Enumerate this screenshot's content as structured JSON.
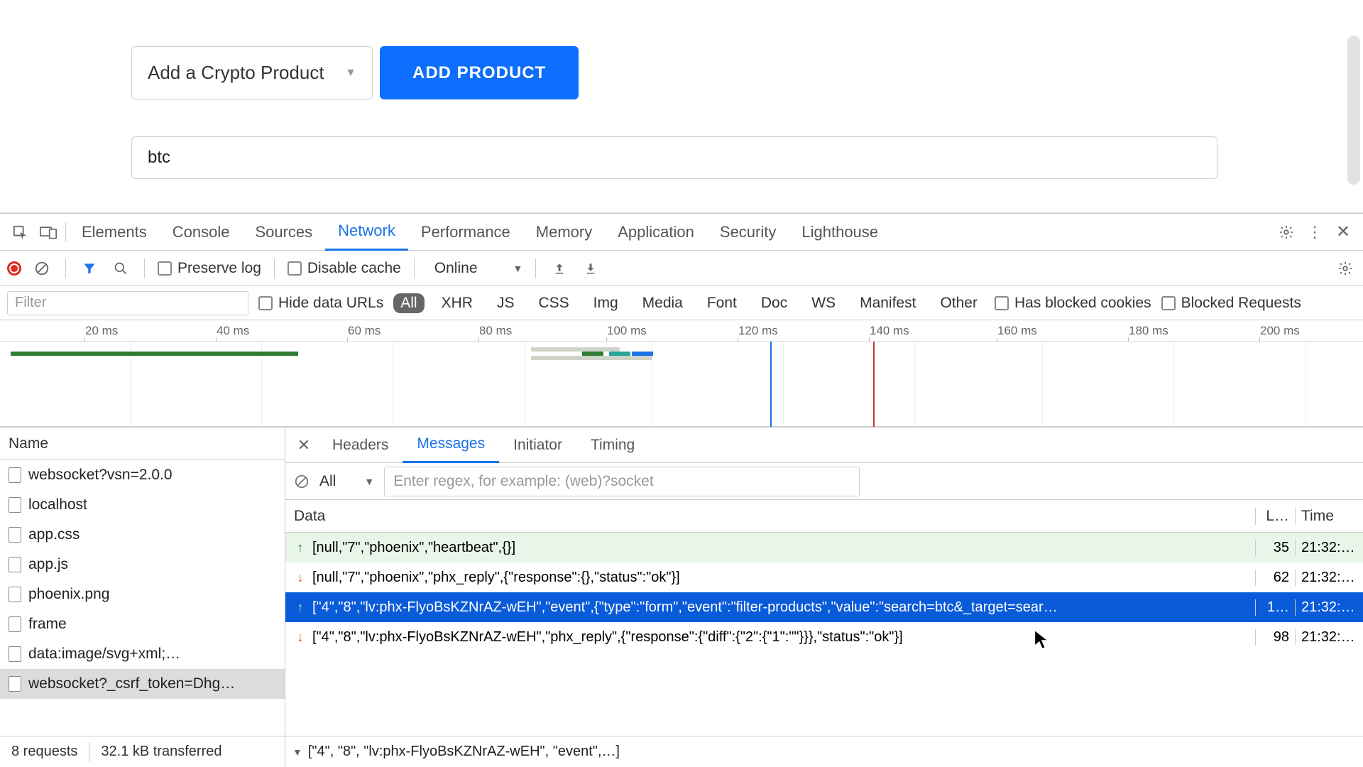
{
  "page": {
    "select_label": "Add a Crypto Product",
    "add_button": "ADD PRODUCT",
    "search_value": "btc"
  },
  "devtools": {
    "tabs": [
      "Elements",
      "Console",
      "Sources",
      "Network",
      "Performance",
      "Memory",
      "Application",
      "Security",
      "Lighthouse"
    ],
    "active_tab": "Network",
    "toolbar": {
      "preserve_log": "Preserve log",
      "disable_cache": "Disable cache",
      "online": "Online"
    },
    "filter": {
      "placeholder": "Filter",
      "hide_data_urls": "Hide data URLs",
      "types": [
        "All",
        "XHR",
        "JS",
        "CSS",
        "Img",
        "Media",
        "Font",
        "Doc",
        "WS",
        "Manifest",
        "Other"
      ],
      "active_type": "All",
      "blocked_cookies": "Has blocked cookies",
      "blocked_requests": "Blocked Requests"
    },
    "timeline_ticks": [
      "20 ms",
      "40 ms",
      "60 ms",
      "80 ms",
      "100 ms",
      "120 ms",
      "140 ms",
      "160 ms",
      "180 ms",
      "200 ms"
    ],
    "name_header": "Name",
    "requests": [
      "websocket?vsn=2.0.0",
      "localhost",
      "app.css",
      "app.js",
      "phoenix.png",
      "frame",
      "data:image/svg+xml;…",
      "websocket?_csrf_token=Dhg…"
    ],
    "selected_request_index": 7,
    "status_bar": {
      "count": "8 requests",
      "transferred": "32.1 kB transferred"
    },
    "detail_tabs": [
      "Headers",
      "Messages",
      "Initiator",
      "Timing"
    ],
    "active_detail_tab": "Messages",
    "msg_filter": {
      "all": "All",
      "placeholder": "Enter regex, for example: (web)?socket"
    },
    "msg_columns": {
      "data": "Data",
      "length": "L…",
      "time": "Time"
    },
    "messages": [
      {
        "dir": "up",
        "data": "[null,\"7\",\"phoenix\",\"heartbeat\",{}]",
        "len": "35",
        "time": "21:32:…",
        "class": "outgoing"
      },
      {
        "dir": "down",
        "data": "[null,\"7\",\"phoenix\",\"phx_reply\",{\"response\":{},\"status\":\"ok\"}]",
        "len": "62",
        "time": "21:32:…",
        "class": ""
      },
      {
        "dir": "up",
        "data": "[\"4\",\"8\",\"lv:phx-FlyoBsKZNrAZ-wEH\",\"event\",{\"type\":\"form\",\"event\":\"filter-products\",\"value\":\"search=btc&_target=sear…",
        "len": "1…",
        "time": "21:32:…",
        "class": "selected"
      },
      {
        "dir": "down",
        "data": "[\"4\",\"8\",\"lv:phx-FlyoBsKZNrAZ-wEH\",\"phx_reply\",{\"response\":{\"diff\":{\"2\":{\"1\":\"\"}}},\"status\":\"ok\"}]",
        "len": "98",
        "time": "21:32:…",
        "class": ""
      }
    ],
    "msg_detail": "[\"4\", \"8\", \"lv:phx-FlyoBsKZNrAZ-wEH\", \"event\",…]"
  }
}
